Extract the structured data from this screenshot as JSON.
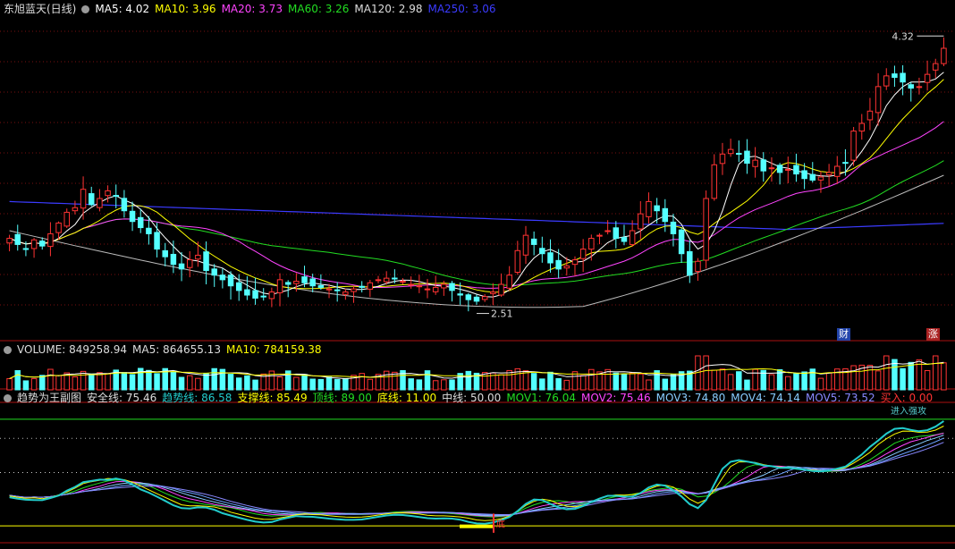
{
  "header": {
    "title": "东旭蓝天(日线)",
    "ma": [
      {
        "label": "MA5: 4.02",
        "color": "#ffffff"
      },
      {
        "label": "MA10: 3.96",
        "color": "#ffff00"
      },
      {
        "label": "MA20: 3.73",
        "color": "#ff44ff"
      },
      {
        "label": "MA60: 3.26",
        "color": "#22dd22"
      },
      {
        "label": "MA120: 2.98",
        "color": "#dddddd"
      },
      {
        "label": "MA250: 3.06",
        "color": "#3b3bff"
      }
    ]
  },
  "volume_header": [
    {
      "label": "VOLUME: 849258.94",
      "color": "#dddddd"
    },
    {
      "label": "MA5: 864655.13",
      "color": "#dddddd"
    },
    {
      "label": "MA10: 784159.38",
      "color": "#ffff00"
    }
  ],
  "indicator_header": {
    "name": "趋势为王副图",
    "items": [
      {
        "label": "安全线: 75.46",
        "color": "#dddddd"
      },
      {
        "label": "趋势线: 86.58",
        "color": "#22cccc"
      },
      {
        "label": "支撑线: 85.49",
        "color": "#ffff00"
      },
      {
        "label": "顶线: 89.00",
        "color": "#22dd22"
      },
      {
        "label": "底线: 11.00",
        "color": "#ffff00"
      },
      {
        "label": "中线: 50.00",
        "color": "#dddddd"
      },
      {
        "label": "MOV1: 76.04",
        "color": "#22dd22"
      },
      {
        "label": "MOV2: 75.46",
        "color": "#ff44ff"
      },
      {
        "label": "MOV3: 74.80",
        "color": "#88ccff"
      },
      {
        "label": "MOV4: 74.14",
        "color": "#88ccff"
      },
      {
        "label": "MOV5: 73.52",
        "color": "#8888ff"
      },
      {
        "label": "买入: 0.00",
        "color": "#ff3333"
      }
    ],
    "annotations": {
      "buy_in": "买入",
      "enter": "进入强攻",
      "left": "底"
    }
  },
  "price_labels": {
    "high": "4.32",
    "low": "2.51"
  },
  "badges": {
    "finance": "财",
    "rise": "涨"
  },
  "chart_data": {
    "type": "candlestick",
    "price_range": [
      2.35,
      4.45
    ],
    "high_marker": 4.32,
    "low_marker": 2.51,
    "closes": [
      3.0,
      2.96,
      2.93,
      2.99,
      2.95,
      3.03,
      3.1,
      3.17,
      3.2,
      3.32,
      3.22,
      3.26,
      3.31,
      3.28,
      3.18,
      3.11,
      3.07,
      3.03,
      2.93,
      2.88,
      2.83,
      2.8,
      2.86,
      2.89,
      2.79,
      2.76,
      2.73,
      2.69,
      2.66,
      2.63,
      2.61,
      2.62,
      2.65,
      2.73,
      2.7,
      2.72,
      2.71,
      2.69,
      2.68,
      2.67,
      2.66,
      2.65,
      2.67,
      2.68,
      2.71,
      2.73,
      2.74,
      2.74,
      2.72,
      2.7,
      2.69,
      2.67,
      2.68,
      2.7,
      2.66,
      2.63,
      2.6,
      2.59,
      2.62,
      2.65,
      2.7,
      2.76,
      2.92,
      3.02,
      2.96,
      2.9,
      2.84,
      2.8,
      2.82,
      2.86,
      2.93,
      3.0,
      3.02,
      3.05,
      3.0,
      2.98,
      3.05,
      3.16,
      3.24,
      3.18,
      3.11,
      3.03,
      2.9,
      2.76,
      2.85,
      3.26,
      3.48,
      3.55,
      3.58,
      3.55,
      3.49,
      3.51,
      3.44,
      3.46,
      3.43,
      3.45,
      3.42,
      3.39,
      3.38,
      3.4,
      3.43,
      3.47,
      3.49,
      3.7,
      3.75,
      3.83,
      3.99,
      4.06,
      4.05,
      4.02,
      3.98,
      3.99,
      4.07,
      4.14,
      4.24
    ],
    "ma5_last": 4.02,
    "ma10_last": 3.96,
    "ma20_last": 3.73,
    "ma60_last": 3.26,
    "ma120_last": 2.98,
    "ma250_last": 3.06,
    "volume_last": 849258.94,
    "volume_ma5": 864655.13,
    "volume_ma10": 784159.38,
    "indicator": {
      "safe": 75.46,
      "trend": 86.58,
      "support": 85.49,
      "top": 89.0,
      "bottom": 11.0,
      "mid": 50.0,
      "mov1": 76.04,
      "mov2": 75.46,
      "mov3": 74.8,
      "mov4": 74.14,
      "mov5": 73.52,
      "buy": 0.0
    }
  }
}
